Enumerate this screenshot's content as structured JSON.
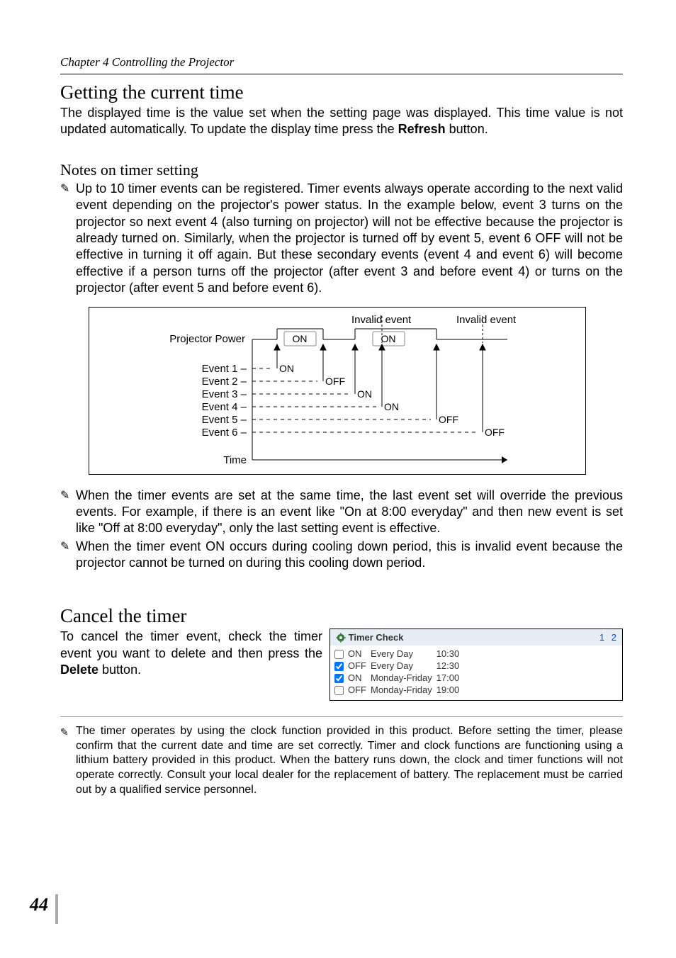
{
  "chapter": "Chapter 4 Controlling the Projector",
  "section1": {
    "heading": "Getting the current time",
    "para_a": "The displayed time is the value set when the setting page was displayed. This time value is not updated automatically. To update the display time press the ",
    "refresh": "Refresh",
    "para_b": " button."
  },
  "section2": {
    "heading": "Notes on timer setting",
    "note1": "Up to 10 timer events can be registered. Timer events always operate according to the next valid event depending on the projector's power status. In the example below, event 3 turns on the projector so next event 4 (also turning on projector) will not be effective because the projector is already turned on. Similarly, when the projector is turned off by event 5, event 6 OFF will not be effective in turning it off again. But these secondary events (event 4 and event 6) will become effective if a person turns off the projector (after event 3 and before event 4) or turns on the projector (after event 5 and before event 6).",
    "note2": "When the timer events are set at the same time, the last event set will override the previous events. For example, if there is an event like \"On at 8:00 everyday\" and then new event is set like \"Off at 8:00 everyday\", only the last setting event is effective.",
    "note3_a": "When the timer event ",
    "note3_on": "ON",
    "note3_b": " occurs during cooling down period, this is invalid event because the projector cannot be turned on during this cooling down period."
  },
  "diagram": {
    "invalid1": "Invalid event",
    "invalid2": "Invalid event",
    "power_label": "Projector Power",
    "on1": "ON",
    "on2": "ON",
    "events": [
      "Event 1",
      "Event 2",
      "Event 3",
      "Event 4",
      "Event 5",
      "Event 6"
    ],
    "event_states": [
      "ON",
      "OFF",
      "ON",
      "ON",
      "OFF",
      "OFF"
    ],
    "time_label": "Time"
  },
  "section3": {
    "heading": "Cancel the timer",
    "para_a": "To cancel the timer event, check the timer event you want to delete and then press the ",
    "delete": "Delete",
    "para_b": " button."
  },
  "timer_panel": {
    "title": "Timer Check",
    "page1": "1",
    "page2": "2",
    "rows": [
      {
        "checked": false,
        "state": "ON",
        "schedule": "Every Day",
        "time": "10:30"
      },
      {
        "checked": true,
        "state": "OFF",
        "schedule": "Every Day",
        "time": "12:30"
      },
      {
        "checked": true,
        "state": "ON",
        "schedule": "Monday-Friday",
        "time": "17:00"
      },
      {
        "checked": false,
        "state": "OFF",
        "schedule": "Monday-Friday",
        "time": "19:00"
      }
    ]
  },
  "footnote": "The timer operates by using the clock function provided in this product. Before setting the timer, please confirm that the current date and time are set correctly. Timer and clock functions are functioning using a lithium battery provided in this product. When the battery runs down, the clock and timer functions will not operate correctly. Consult your local dealer for the replacement of battery. The replacement must be carried out by a qualified service personnel.",
  "page_number": "44"
}
